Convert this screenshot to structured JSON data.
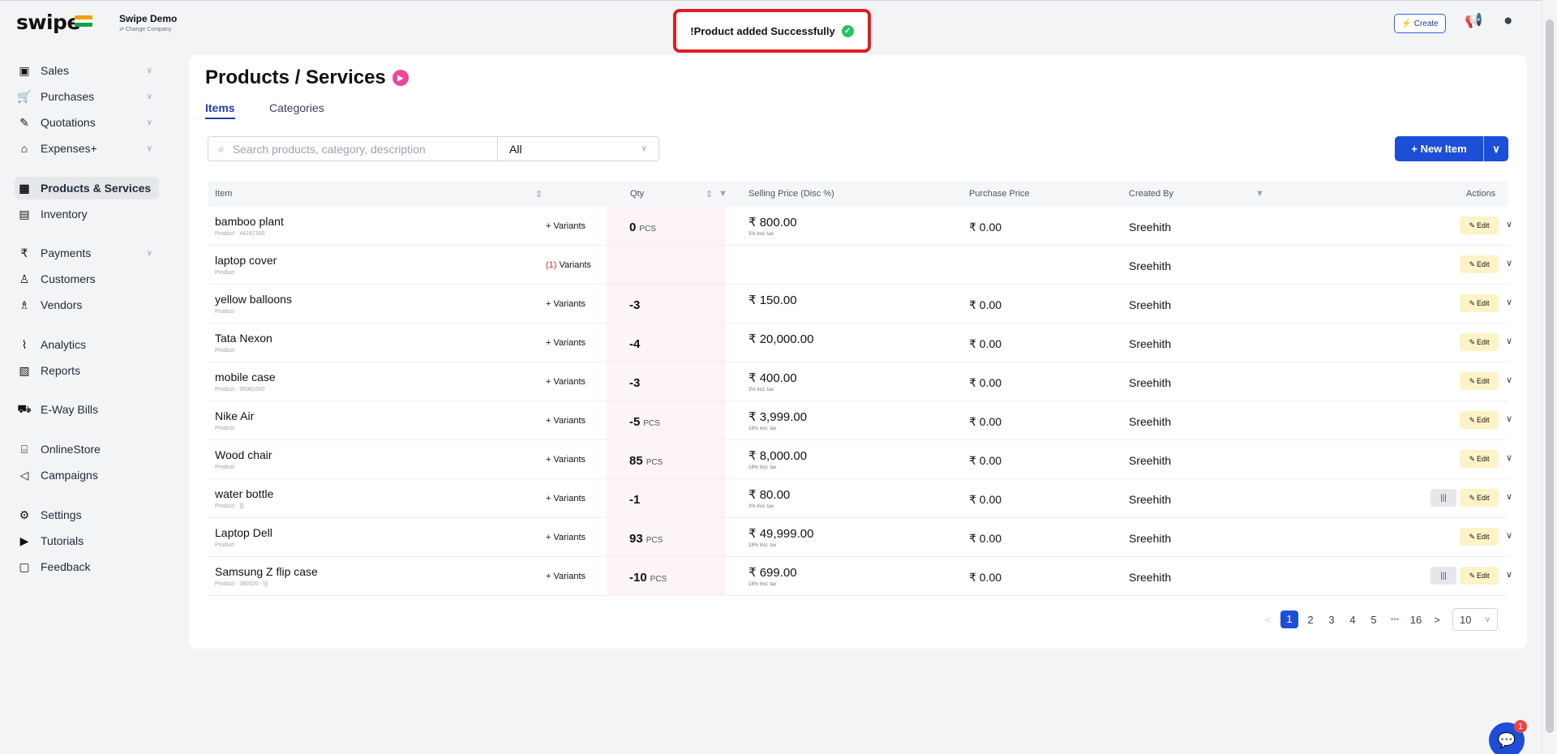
{
  "header": {
    "logo_text": "swipe",
    "company_name": "Swipe Demo",
    "company_sub": "⇄ Change Company",
    "create_label": "Create",
    "toast": "!Product added Successfully"
  },
  "sidebar": {
    "items": [
      {
        "label": "Sales",
        "icon": "sales-icon",
        "glyph": "▣",
        "chevron": true
      },
      {
        "label": "Purchases",
        "icon": "cart-icon",
        "glyph": "🛒",
        "chevron": true
      },
      {
        "label": "Quotations",
        "icon": "pen-icon",
        "glyph": "✎",
        "chevron": true
      },
      {
        "label": "Expenses+",
        "icon": "tag-icon",
        "glyph": "⌂",
        "chevron": true
      },
      {
        "label": "Products & Services",
        "icon": "barcode-icon",
        "glyph": "▦",
        "chevron": false,
        "active": true
      },
      {
        "label": "Inventory",
        "icon": "warehouse-icon",
        "glyph": "▤",
        "chevron": false
      },
      {
        "label": "Payments",
        "icon": "rupee-icon",
        "glyph": "₹",
        "chevron": true
      },
      {
        "label": "Customers",
        "icon": "user-icon",
        "glyph": "♙",
        "chevron": false
      },
      {
        "label": "Vendors",
        "icon": "users-icon",
        "glyph": "♗",
        "chevron": false
      },
      {
        "label": "Analytics",
        "icon": "chart-icon",
        "glyph": "⌇",
        "chevron": false
      },
      {
        "label": "Reports",
        "icon": "report-icon",
        "glyph": "▧",
        "chevron": false
      },
      {
        "label": "E-Way Bills",
        "icon": "truck-icon",
        "glyph": "⛟",
        "chevron": false
      },
      {
        "label": "OnlineStore",
        "icon": "store-icon",
        "glyph": "⌸",
        "chevron": false
      },
      {
        "label": "Campaigns",
        "icon": "megaphone-icon",
        "glyph": "◁",
        "chevron": false
      },
      {
        "label": "Settings",
        "icon": "gear-icon",
        "glyph": "⚙",
        "chevron": false
      },
      {
        "label": "Tutorials",
        "icon": "youtube-icon",
        "glyph": "▶",
        "chevron": false
      },
      {
        "label": "Feedback",
        "icon": "feedback-icon",
        "glyph": "▢",
        "chevron": false
      }
    ]
  },
  "main": {
    "title": "Products / Services",
    "tabs": [
      "Items",
      "Categories"
    ],
    "search_placeholder": "Search products, category, description",
    "filter_value": "All",
    "new_item_label": "+ New Item",
    "columns": {
      "item": "Item",
      "qty": "Qty",
      "selling": "Selling Price (Disc %)",
      "purchase": "Purchase Price",
      "created_by": "Created By",
      "actions": "Actions"
    },
    "rows": [
      {
        "name": "bamboo plant",
        "sub": "Product · 44187300",
        "variants": "+ Variants",
        "qty": "0",
        "unit": "PCS",
        "sp": "₹ 800.00",
        "sp_sub": "5% Incl. tax",
        "pp": "₹ 0.00",
        "by": "Sreehith",
        "barcode": false
      },
      {
        "name": "laptop cover",
        "sub": "Product",
        "variants_count": "(1)",
        "variants": "Variants",
        "qty": "",
        "unit": "",
        "sp": "",
        "sp_sub": "",
        "pp": "",
        "by": "Sreehith",
        "barcode": false
      },
      {
        "name": "yellow balloons",
        "sub": "Product",
        "variants": "+ Variants",
        "qty": "-3",
        "unit": "",
        "sp": "₹ 150.00",
        "sp_sub": "",
        "pp": "₹ 0.00",
        "by": "Sreehith",
        "barcode": false
      },
      {
        "name": "Tata Nexon",
        "sub": "Product",
        "variants": "+ Variants",
        "qty": "-4",
        "unit": "",
        "sp": "₹ 20,000.00",
        "sp_sub": "",
        "pp": "₹ 0.00",
        "by": "Sreehith",
        "barcode": false
      },
      {
        "name": "mobile case",
        "sub": "Product · 96081000",
        "variants": "+ Variants",
        "qty": "-3",
        "unit": "",
        "sp": "₹ 400.00",
        "sp_sub": "3% Incl. tax",
        "pp": "₹ 0.00",
        "by": "Sreehith",
        "barcode": false
      },
      {
        "name": "Nike Air",
        "sub": "Product",
        "variants": "+ Variants",
        "qty": "-5",
        "unit": "PCS",
        "sp": "₹ 3,999.00",
        "sp_sub": "18% Incl. tax",
        "pp": "₹ 0.00",
        "by": "Sreehith",
        "barcode": false
      },
      {
        "name": "Wood chair",
        "sub": "Product",
        "variants": "+ Variants",
        "qty": "85",
        "unit": "PCS",
        "sp": "₹ 8,000.00",
        "sp_sub": "18% Incl. tax",
        "pp": "₹ 0.00",
        "by": "Sreehith",
        "barcode": false
      },
      {
        "name": "water bottle",
        "sub": "Product · |||",
        "variants": "+ Variants",
        "qty": "-1",
        "unit": "",
        "sp": "₹ 80.00",
        "sp_sub": "3% Incl. tax",
        "pp": "₹ 0.00",
        "by": "Sreehith",
        "barcode": true
      },
      {
        "name": "Laptop Dell",
        "sub": "Product",
        "variants": "+ Variants",
        "qty": "93",
        "unit": "PCS",
        "sp": "₹ 49,999.00",
        "sp_sub": "18% Incl. tax",
        "pp": "₹ 0.00",
        "by": "Sreehith",
        "barcode": false
      },
      {
        "name": "Samsung Z flip case",
        "sub": "Product · 392620 · |||",
        "variants": "+ Variants",
        "qty": "-10",
        "unit": "PCS",
        "sp": "₹ 699.00",
        "sp_sub": "18% Incl. tax",
        "pp": "₹ 0.00",
        "by": "Sreehith",
        "barcode": true
      }
    ],
    "edit_label": "Edit",
    "pagination": {
      "prev": "<",
      "pages": [
        "1",
        "2",
        "3",
        "4",
        "5"
      ],
      "ellipsis": "•••",
      "last": "16",
      "next": ">",
      "page_size": "10"
    }
  },
  "chat_badge": "1"
}
